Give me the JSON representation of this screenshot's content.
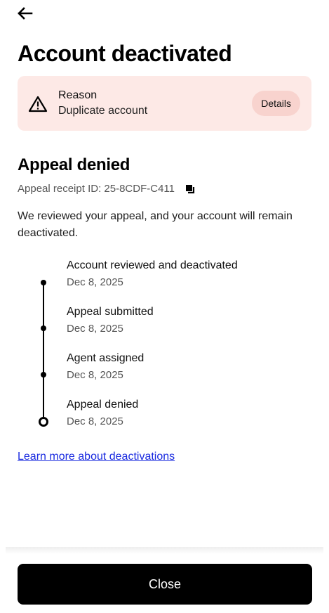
{
  "header": {
    "title": "Account deactivated"
  },
  "reason": {
    "label": "Reason",
    "value": "Duplicate account",
    "details_label": "Details"
  },
  "appeal": {
    "title": "Appeal denied",
    "receipt": "Appeal receipt ID: 25-8CDF-C411",
    "description": "We reviewed your appeal, and your account will remain deactivated."
  },
  "timeline": [
    {
      "title": "Account reviewed and deactivated",
      "date": "Dec 8, 2025"
    },
    {
      "title": "Appeal submitted",
      "date": "Dec 8, 2025"
    },
    {
      "title": "Agent assigned",
      "date": "Dec 8, 2025"
    },
    {
      "title": "Appeal denied",
      "date": "Dec 8, 2025"
    }
  ],
  "learn_more": "Learn more about deactivations",
  "footer": {
    "close_label": "Close"
  },
  "icons": {
    "back": "arrow-left-icon",
    "warning": "warning-triangle-icon",
    "copy": "copy-icon"
  },
  "colors": {
    "reason_bg": "#fde9e6",
    "details_bg": "#f8d3ce",
    "link": "#1a2be0",
    "primary_button": "#000000"
  }
}
